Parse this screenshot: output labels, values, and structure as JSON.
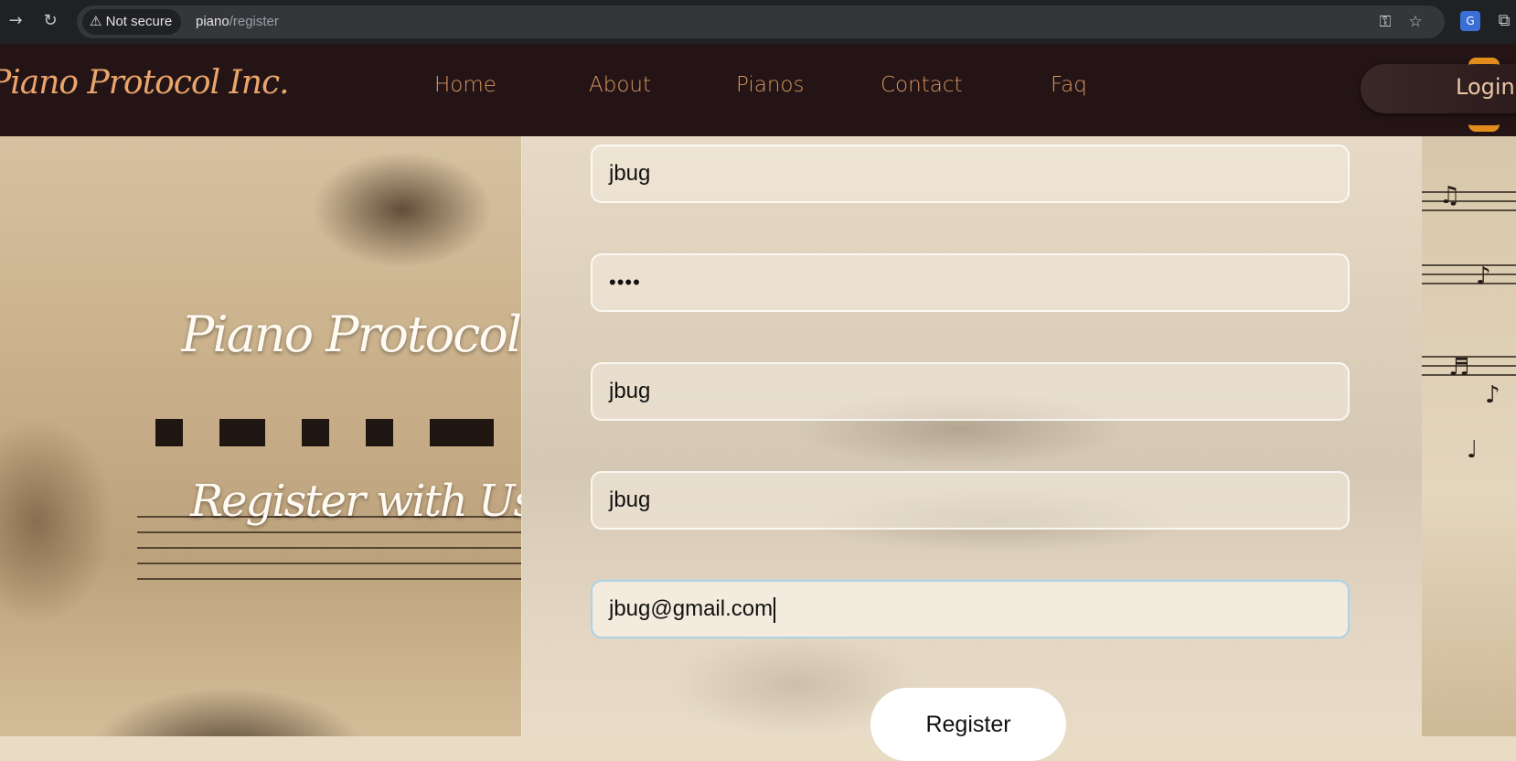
{
  "browser": {
    "security_label": "Not secure",
    "url_host": "piano",
    "url_path": "/register"
  },
  "site": {
    "logo": "Piano Protocol Inc.",
    "nav": [
      "Home",
      "About",
      "Pianos",
      "Contact",
      "Faq"
    ],
    "login_label": "Login"
  },
  "hero": {
    "title": "Piano Protocol Inc",
    "subtitle": "Register with Us!"
  },
  "form": {
    "fields": [
      {
        "value": "jbug"
      },
      {
        "value": "••••"
      },
      {
        "value": "jbug"
      },
      {
        "value": "jbug"
      },
      {
        "value": "jbug@gmail.com"
      }
    ],
    "submit_label": "Register"
  },
  "colors": {
    "header_bg": "#241415",
    "nav_text": "#d79761",
    "focus_ring": "#a9d3ea"
  }
}
